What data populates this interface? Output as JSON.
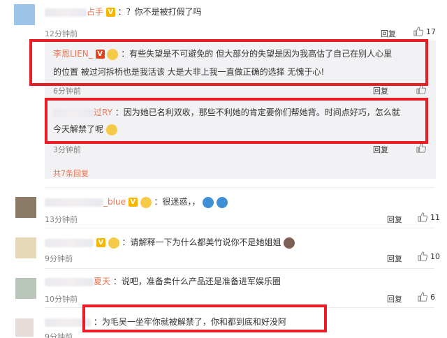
{
  "comments": [
    {
      "name_visible": "占手",
      "text": "：？你不是被打假了吗",
      "time": "12分钟前",
      "reply": "回复",
      "likes": "17"
    },
    {
      "name_visible": "_blue",
      "text": "：很迷惑，，",
      "time": "13分钟前",
      "reply": "回复",
      "likes": "11"
    },
    {
      "name_visible": "",
      "text": "：请解释一下为什么都美竹说你不是她姐姐",
      "time": "9分钟前",
      "reply": "回复",
      "likes": "10"
    },
    {
      "name_visible": "夏天",
      "text": "：说吧，准备卖什么产品还是准备进军娱乐圈",
      "time": "10分钟前",
      "reply": "回复",
      "likes": "6"
    },
    {
      "name_visible": "",
      "text": "：为毛吴一坐牢你就被解禁了，你和都到底和好没阿",
      "time": "9分钟前",
      "reply": "回复",
      "likes": ""
    }
  ],
  "sub_replies": [
    {
      "name": "李恩LIEN_",
      "text_line1": "：有些失望是不可避免的 但大部分的失望是因为我高估了自己在别人心里",
      "text_line2": "的位置 被过河拆桥也是我活该 大是大非上我一直做正确的选择 无愧于心!",
      "time": "6分钟前",
      "reply": "回复"
    },
    {
      "name_visible": "过RY",
      "text_line1": "：因为她已名利双收，那些不利她的肯定要你们帮她背。时间点好巧，怎么就",
      "text_line2": "今天解禁了呢",
      "time": "3分钟前",
      "reply": "回复"
    }
  ],
  "more_replies": "共7条回复",
  "colors": {
    "highlight_border": "#ea1c24",
    "username": "#eb7350",
    "sub_panel": "#f2f2f5"
  }
}
